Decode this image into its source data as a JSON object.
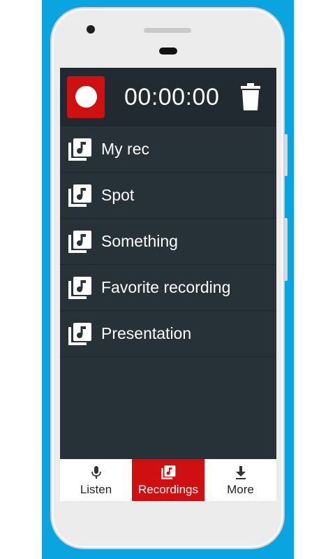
{
  "colors": {
    "background": "#0aa4e0",
    "screen": "#263238",
    "topbar": "#212a30",
    "accent": "#d01010",
    "text": "#ffffff"
  },
  "header": {
    "record_icon": "record-circle-icon",
    "timer": "00:00:00",
    "delete_icon": "trash-icon"
  },
  "recordings": [
    {
      "label": "My rec",
      "icon": "music-library-icon"
    },
    {
      "label": "Spot",
      "icon": "music-library-icon"
    },
    {
      "label": "Something",
      "icon": "music-library-icon"
    },
    {
      "label": "Favorite recording",
      "icon": "music-library-icon"
    },
    {
      "label": "Presentation",
      "icon": "music-library-icon"
    }
  ],
  "bottom_nav": {
    "active": "Recordings",
    "items": [
      {
        "label": "Listen",
        "icon": "microphone-icon"
      },
      {
        "label": "Recordings",
        "icon": "music-library-icon"
      },
      {
        "label": "More",
        "icon": "download-icon"
      }
    ]
  }
}
